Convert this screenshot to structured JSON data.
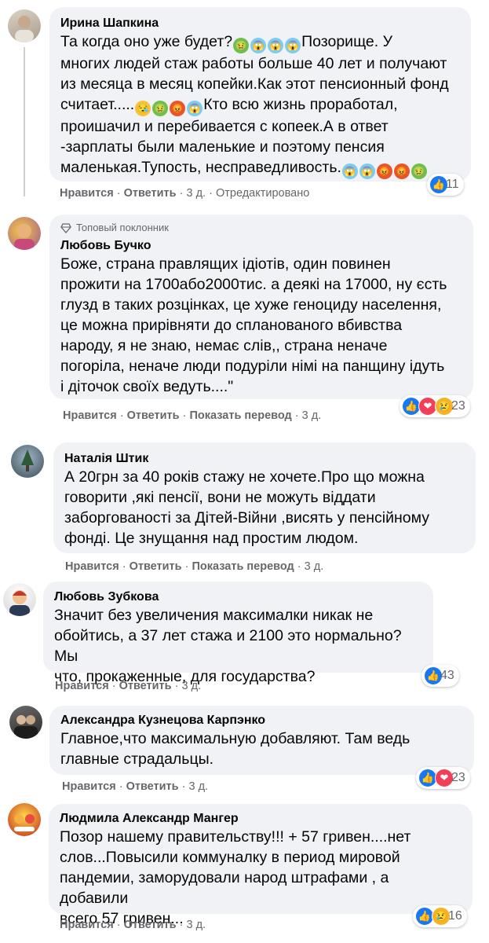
{
  "comments": [
    {
      "author": "Ирина Шапкина",
      "lines": [
        "Та когда оно уже будет?",
        "Позорище. У",
        "многих людей стаж работы больше 40 лет и получают",
        "из месяца в месяц копейки.Как этот пенсионный фонд",
        "считает.....",
        "Кто всю жизнь проработал,",
        "проишачил и перебивается с копеек.А в ответ",
        "-зарплаты были маленькие и поэтому пенсия",
        "маленькая.Тупость, несправедливость."
      ],
      "like": "Нравится",
      "reply": "Ответить",
      "time": "3 д.",
      "edited": "Отредактировано",
      "react_count": "11"
    },
    {
      "badge": "Топовый поклонник",
      "author": "Любовь Бучко",
      "lines": [
        "Боже, страна правлящих ідіотів, один повинен",
        "прожити на 1700або2000тис. а деякі на 17000, ну єсть",
        "глузд в таких розцінках, це хуже геноциду населення,",
        "це можна прирівняти до спланованого вбивства",
        "народу, я не знаю, немає слів,, страна неначе",
        "погоріла, неначе люди подуріли німі на панщину ідуть",
        "і діточок своїх ведуть....\""
      ],
      "like": "Нравится",
      "reply": "Ответить",
      "translate": "Показать перевод",
      "time": "3 д.",
      "react_count": "23"
    },
    {
      "author": "Наталія Штик",
      "lines": [
        "А 20грн за 40 років стажу не хочете.Про що можна",
        "говорити ,які пенсії, вони не можуть віддати",
        "заборгованості за Дітей-Війни ,висять у пенсійному",
        "фонді. Це знущання над простим людом."
      ],
      "like": "Нравится",
      "reply": "Ответить",
      "translate": "Показать перевод",
      "time": "3 д."
    },
    {
      "author": "Любовь Зубкова",
      "lines": [
        "Значит без увеличения максималки никак не",
        "обойтись, а 37 лет стажа и 2100 это нормально? Мы",
        "что, прокаженные, для государства?"
      ],
      "like": "Нравится",
      "reply": "Ответить",
      "time": "3 д.",
      "react_count": "43"
    },
    {
      "author": "Александра Кузнецова Карпэнко",
      "lines": [
        "Главное,что максимальную добавляют. Там ведь",
        "главные страдальцы."
      ],
      "like": "Нравится",
      "reply": "Ответить",
      "time": "3 д.",
      "react_count": "23"
    },
    {
      "author": "Людмила Александр Мангер",
      "lines": [
        "Позор нашему правительству!!! + 57 гривен....нет",
        "слов...Повысили коммуналку в период мировой",
        "пандемии, заморудовали народ штрафами , а добавили",
        "всего 57 гривен..."
      ],
      "like": "Нравится",
      "reply": "Ответить",
      "time": "3 д.",
      "react_count": "16"
    }
  ],
  "sep": "·",
  "colors": {
    "bubble": "#f0f2f5",
    "like": "#1877f2",
    "love": "#f33e58",
    "sad": "#f7b125",
    "meta": "#65676b"
  }
}
